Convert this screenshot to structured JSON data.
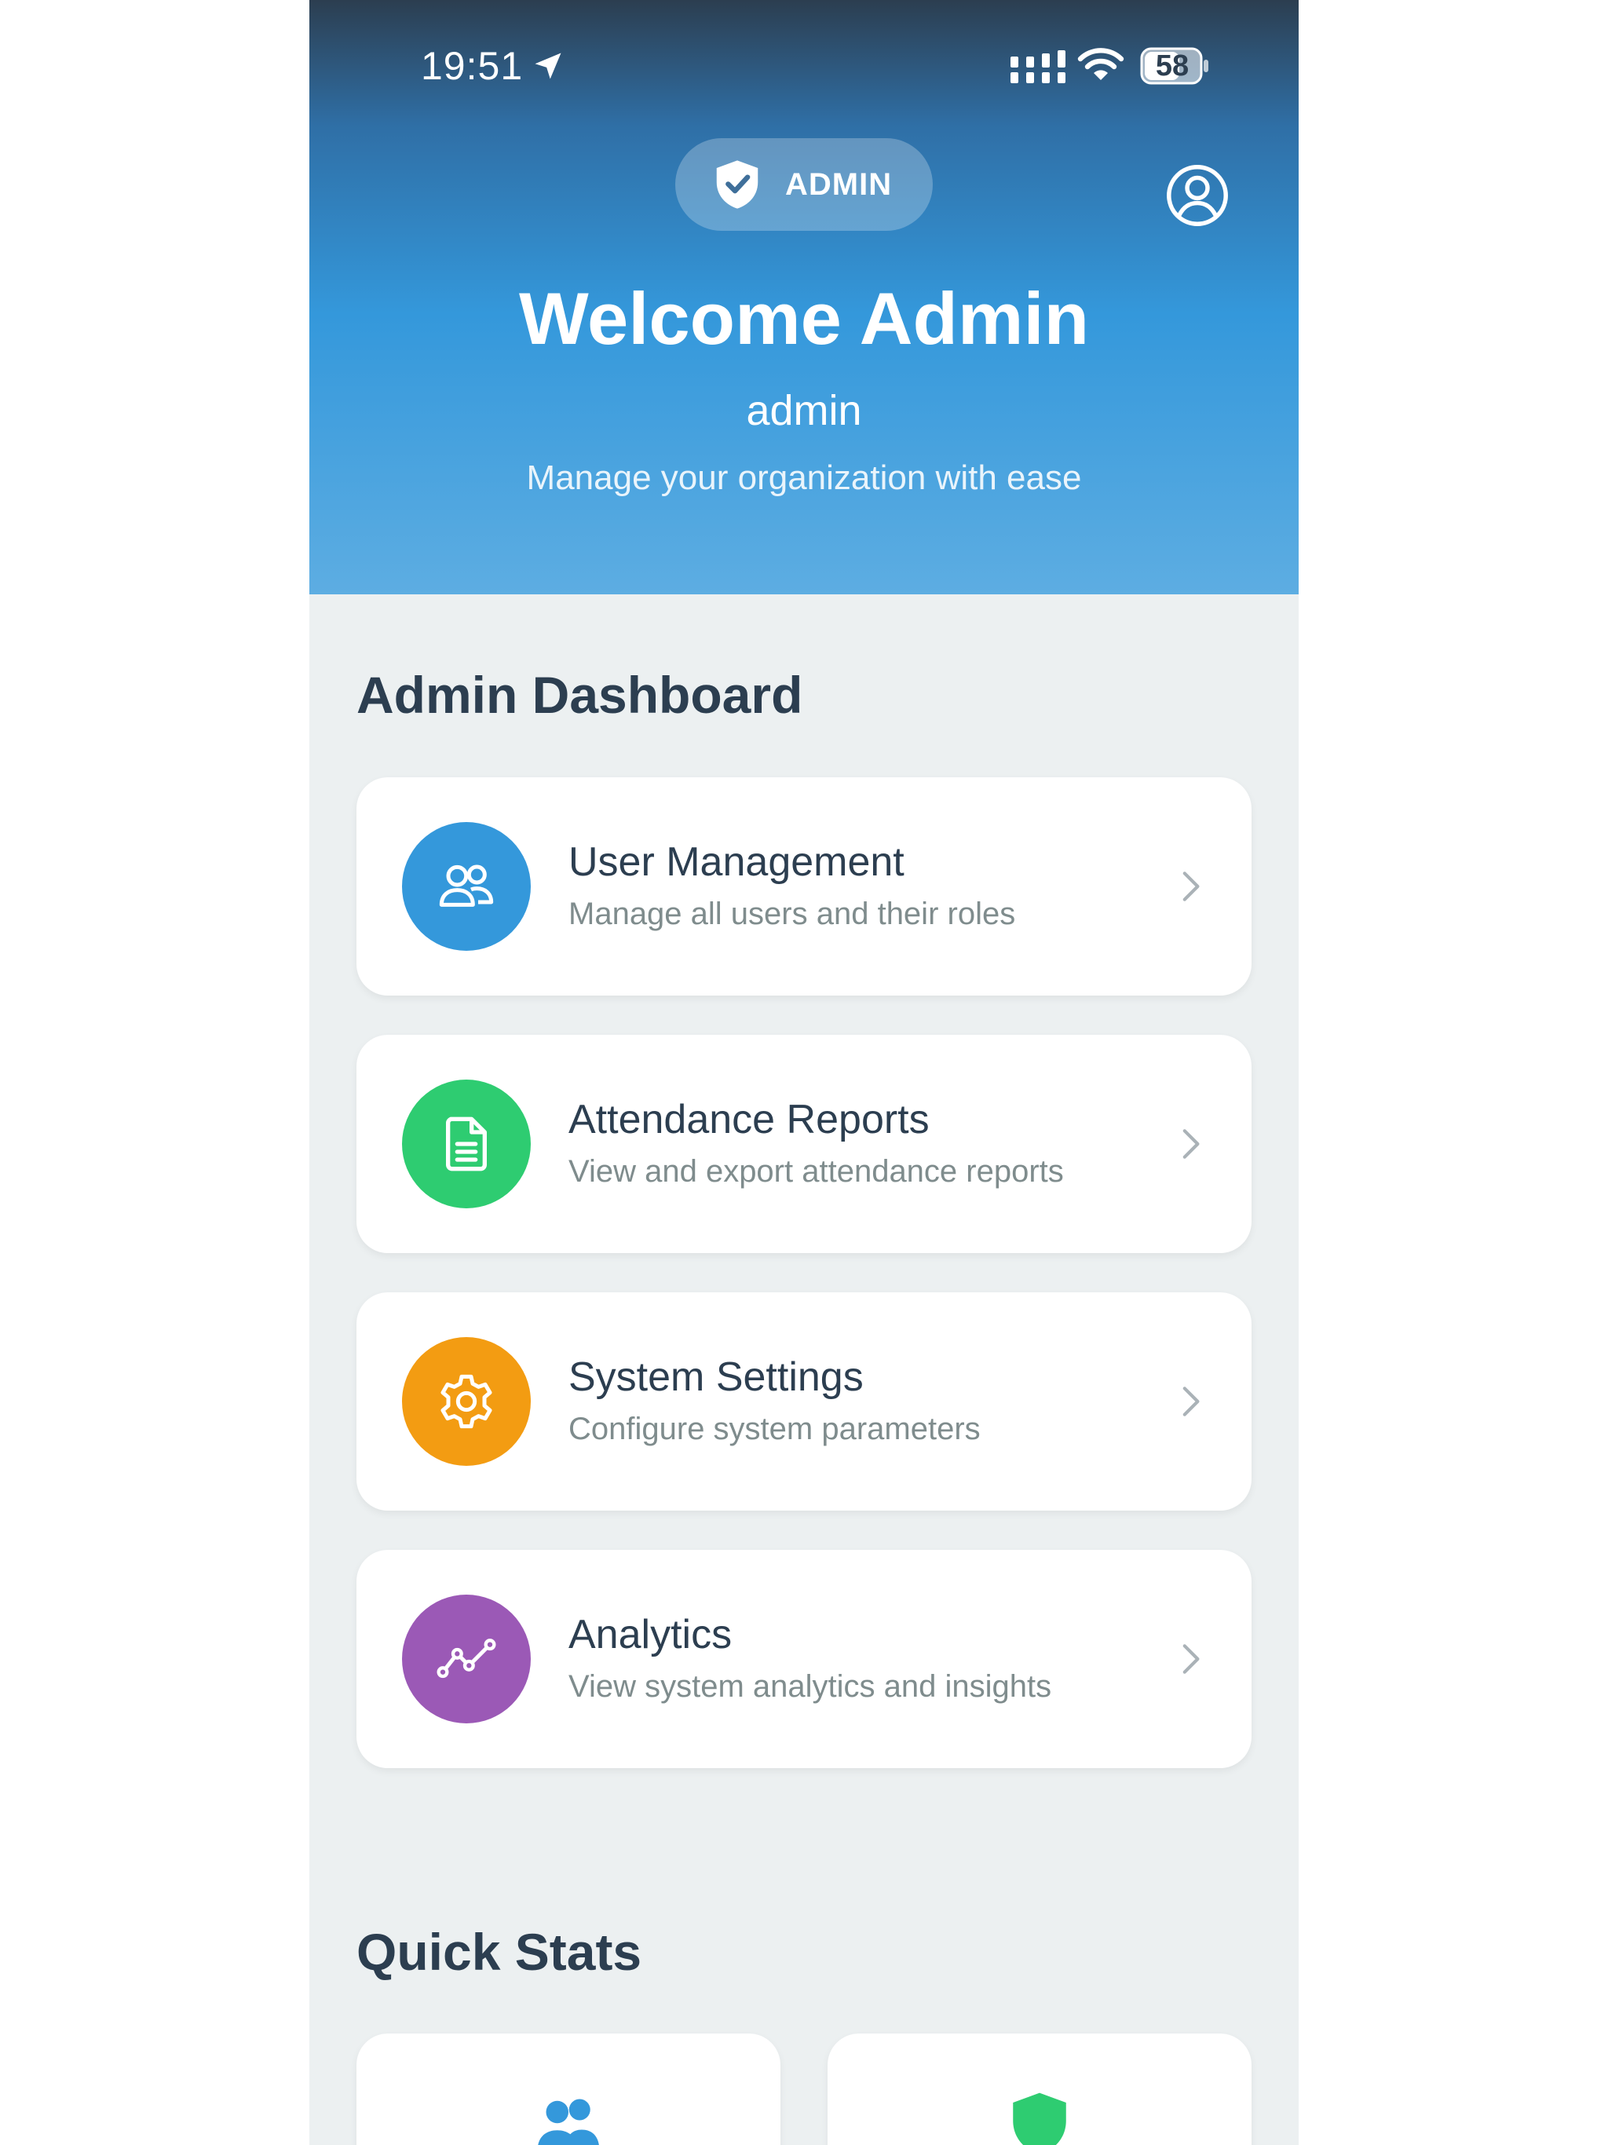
{
  "status_bar": {
    "time": "19:51",
    "battery": "58",
    "icons": [
      "location-arrow-icon",
      "cellular-signal-icon",
      "wifi-icon",
      "battery-icon"
    ]
  },
  "header": {
    "role_badge": "ADMIN",
    "role_icon": "shield-check-icon",
    "profile_icon": "user-circle-icon",
    "title": "Welcome Admin",
    "username": "admin",
    "tagline": "Manage your organization with ease"
  },
  "dashboard": {
    "title": "Admin Dashboard",
    "items": [
      {
        "title": "User Management",
        "subtitle": "Manage all users and their roles",
        "icon": "users-icon",
        "color": "#3498db"
      },
      {
        "title": "Attendance Reports",
        "subtitle": "View and export attendance reports",
        "icon": "document-icon",
        "color": "#2ecc71"
      },
      {
        "title": "System Settings",
        "subtitle": "Configure system parameters",
        "icon": "gear-icon",
        "color": "#f39c12"
      },
      {
        "title": "Analytics",
        "subtitle": "View system analytics and insights",
        "icon": "trend-chart-icon",
        "color": "#9b59b6"
      }
    ]
  },
  "quick_stats": {
    "title": "Quick Stats",
    "cards": [
      {
        "icon": "users-icon",
        "color": "#3498db"
      },
      {
        "icon": "shield-icon",
        "color": "#2ecc71"
      }
    ]
  },
  "colors": {
    "header_gradient_top": "#2c3e50",
    "header_gradient_bottom": "#5dade2",
    "background": "#ecf0f1",
    "title_text": "#2c3e50",
    "subtitle_text": "#7f8c8d"
  }
}
